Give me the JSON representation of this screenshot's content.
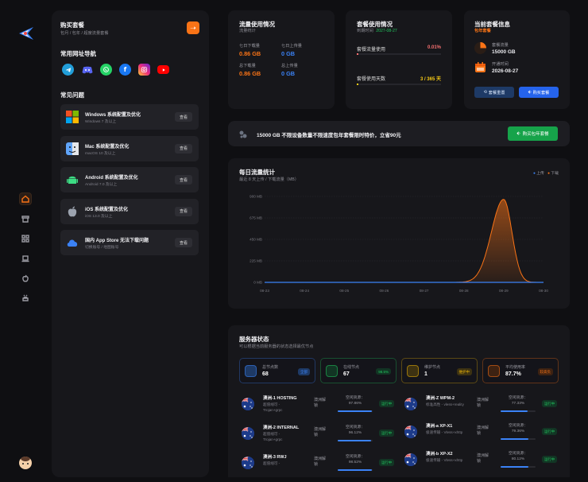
{
  "buy_card": {
    "title": "购买套餐",
    "subtitle": "包月 / 包年 / 超度流量套餐"
  },
  "links": {
    "title": "常用网址导航",
    "icons": [
      "telegram-icon",
      "discord-icon",
      "whatsapp-icon",
      "facebook-icon",
      "instagram-icon",
      "youtube-icon"
    ]
  },
  "faq": {
    "title": "常见问题",
    "button_label": "查看",
    "items": [
      {
        "title": "Windows 系统配置及优化",
        "sub": "Windows 7 及以上",
        "icon": "windows-icon"
      },
      {
        "title": "Mac 系统配置及优化",
        "sub": "macOS 10 及以上",
        "icon": "finder-icon"
      },
      {
        "title": "Android 系统配置及优化",
        "sub": "Android 7.0 及以上",
        "icon": "android-icon"
      },
      {
        "title": "iOS 系统配置及优化",
        "sub": "iOS 13.0 及以上",
        "icon": "apple-icon"
      },
      {
        "title": "国内 App Store 无法下载问题",
        "sub": "切换账号 / 地图账号",
        "icon": "cloud-icon"
      }
    ]
  },
  "traffic": {
    "title": "流量使用情况",
    "subtitle": "流量统计",
    "items": [
      {
        "label": "七日下载量",
        "value": "0.86 GB",
        "color": "#f97316"
      },
      {
        "label": "七日上传量",
        "value": "0 GB",
        "color": "#3b82f6"
      },
      {
        "label": "总下载量",
        "value": "0.86 GB",
        "color": "#f97316"
      },
      {
        "label": "总上传量",
        "value": "0 GB",
        "color": "#3b82f6"
      }
    ]
  },
  "usage": {
    "title": "套餐使用情况",
    "expire_label": "到期时间",
    "expire_date": "2027-08-27",
    "rows": [
      {
        "label": "套餐流量使用",
        "value": "0.01%",
        "color": "#f87171",
        "progress": 0.0001
      },
      {
        "label": "套餐使用天数",
        "value": "3 / 365 天",
        "color": "#facc15",
        "progress": 0.008
      }
    ]
  },
  "plan": {
    "title": "当前套餐信息",
    "type": "包年套餐",
    "traffic_label": "套餐流量",
    "traffic_value": "15000 GB",
    "start_label": "开通时间",
    "start_value": "2026-08-27",
    "btn_renew": "套餐重置",
    "btn_buy": "购买套餐"
  },
  "banner": {
    "text": "15000 GB 不限设备数量不限速度包年套餐限时特价，立省90元",
    "button": "购买包年套餐"
  },
  "chart_data": {
    "type": "area",
    "title": "每日流量统计",
    "subtitle": "最近 8 天上传 / 下载流量（MB）",
    "x": [
      "08-23",
      "08-24",
      "08-25",
      "08-26",
      "08-27",
      "08-28",
      "08-29",
      "08-30"
    ],
    "ylim": [
      0,
      900
    ],
    "yticks": [
      "0 MB",
      "225 MB",
      "450 MB",
      "675 MB",
      "900 MB"
    ],
    "grid": true,
    "legend": "top-right",
    "series": [
      {
        "name": "上传",
        "color": "#3b82f6",
        "values": [
          0,
          0,
          0,
          0,
          0,
          0,
          0,
          0
        ]
      },
      {
        "name": "下载",
        "color": "#f97316",
        "values": [
          0,
          0,
          0,
          0,
          0,
          0,
          870,
          0
        ]
      }
    ]
  },
  "servers": {
    "title": "服务器状态",
    "subtitle": "可以根据当前服务器的状态选择最优节点",
    "stats": [
      {
        "label": "总节点数",
        "value": "68",
        "badge": "全部",
        "color": "#3b82f6"
      },
      {
        "label": "在线节点",
        "value": "67",
        "badge": "98.5%",
        "color": "#22c55e"
      },
      {
        "label": "维护节点",
        "value": "1",
        "badge": "维护中",
        "color": "#eab308"
      },
      {
        "label": "平均使用率",
        "value": "87.7%",
        "badge": "较高负",
        "color": "#f97316"
      }
    ],
    "left": [
      {
        "name": "澳洲-1 HOSTING",
        "line": "超值线可 -",
        "proto": "Trojan+grpc",
        "type": "澳洲解锁",
        "usage_label": "空闲资源：",
        "usage": "97.86%",
        "fill": 0.98,
        "status": "运行中"
      },
      {
        "name": "澳洲-2 INTERNAL",
        "line": "超值线可 -",
        "proto": "Trojan+grpc",
        "type": "澳洲解锁",
        "usage_label": "空闲资源：",
        "usage": "96.12%",
        "fill": 0.96,
        "status": "运行中"
      },
      {
        "name": "澳洲-3 RWJ",
        "line": "超值线可 -",
        "proto": "",
        "type": "澳洲解锁",
        "usage_label": "空闲资源：",
        "usage": "98.52%",
        "fill": 0.98,
        "status": "运行中"
      }
    ],
    "right": [
      {
        "name": "澳洲-Z WPM-2",
        "line": "标准高性 - vless+reality",
        "type": "澳洲解锁",
        "usage_label": "空闲资源：",
        "usage": "77.33%",
        "fill": 0.77,
        "status": "运行中"
      },
      {
        "name": "澳洲-a XP-X1",
        "line": "极速传输 - Vless+xhttp",
        "type": "澳洲解锁",
        "usage_label": "空闲资源：",
        "usage": "79.36%",
        "fill": 0.79,
        "status": "运行中"
      },
      {
        "name": "澳洲-b XP-X2",
        "line": "极速传输 - Vless+xhttp",
        "type": "澳洲解锁",
        "usage_label": "空闲资源：",
        "usage": "80.12%",
        "fill": 0.8,
        "status": "运行中"
      }
    ]
  }
}
